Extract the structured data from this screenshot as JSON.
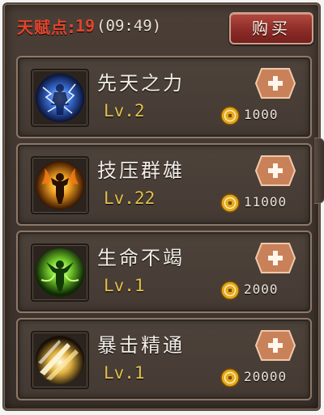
{
  "header": {
    "talent_label": "天赋点:",
    "talent_points": "19",
    "timer": "(09:49)",
    "buy_label": "购买"
  },
  "skills": [
    {
      "name": "先天之力",
      "level": "Lv.2",
      "cost": "1000",
      "icon": "blue-lightning-figure-icon"
    },
    {
      "name": "技压群雄",
      "level": "Lv.22",
      "cost": "11000",
      "icon": "fire-figure-icon"
    },
    {
      "name": "生命不竭",
      "level": "Lv.1",
      "cost": "2000",
      "icon": "green-life-figure-icon"
    },
    {
      "name": "暴击精通",
      "level": "Lv.1",
      "cost": "20000",
      "icon": "critical-slash-icon"
    }
  ],
  "colors": {
    "talent_red": "#e0452c",
    "level_gold": "#e2c04a",
    "plus_button": "#c9815a",
    "buy_button": "#8e2c28"
  }
}
